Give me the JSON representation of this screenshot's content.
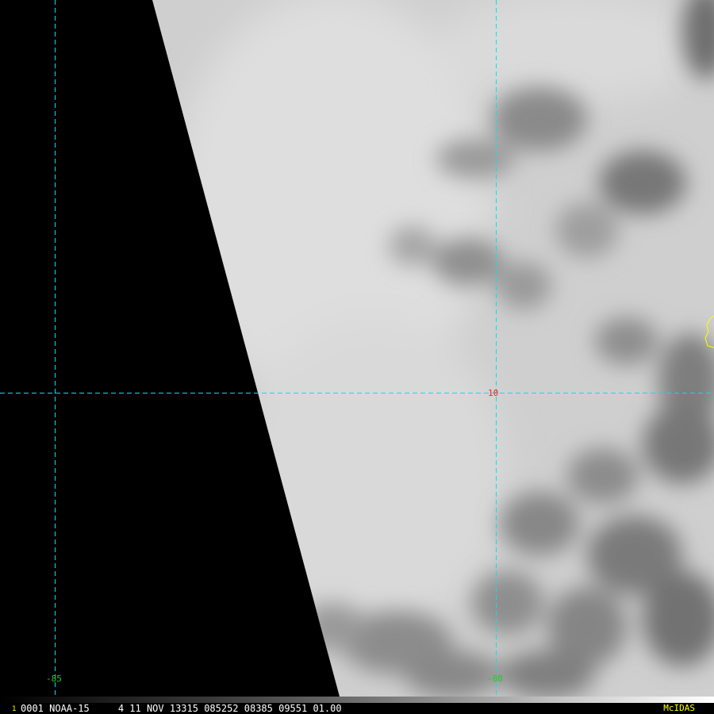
{
  "grid": {
    "lon_label_left": "-85",
    "lon_label_right": "-80",
    "lat_label": "10"
  },
  "status": {
    "frame_index": "1",
    "text": "0001 NOAA-15     4 11 NOV 13315 085252 08385 09551 01.00",
    "brand": "McIDAS"
  },
  "colors": {
    "grid_line": "#00e5e5",
    "lon_label": "#22cc22",
    "lat_label": "#ff2020",
    "coastline": "#ffff00",
    "status_text": "#ffffff",
    "frame_index": "#ffff00",
    "brand": "#ffff00"
  }
}
